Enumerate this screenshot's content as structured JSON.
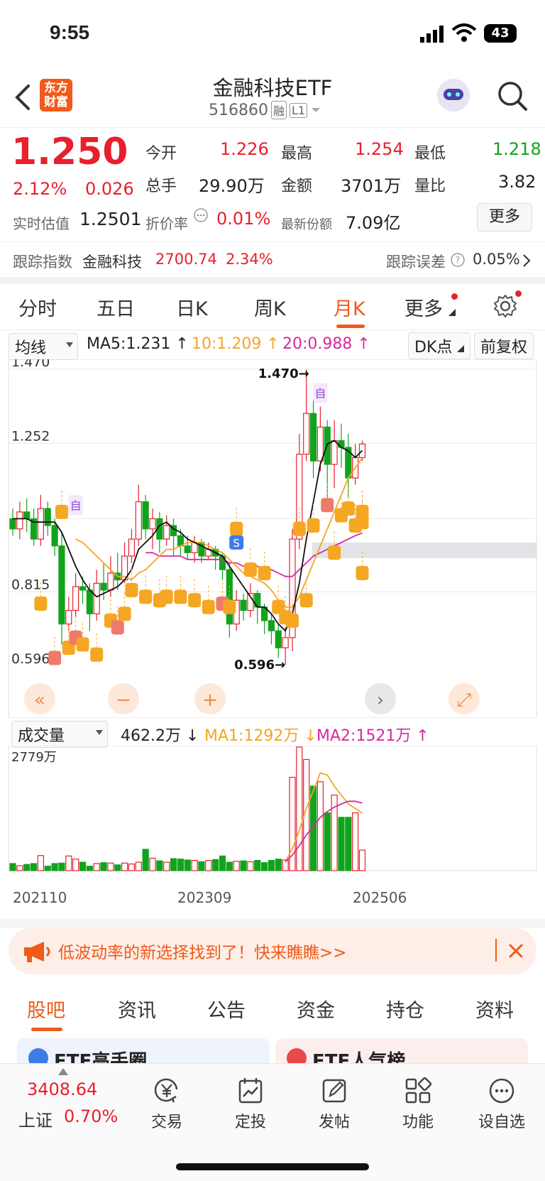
{
  "status": {
    "time": "9:55",
    "battery": "43"
  },
  "header": {
    "logo_line1": "东方",
    "logo_line2": "财富",
    "title": "金融科技ETF",
    "code": "516860",
    "tag1": "融",
    "tag2": "L1"
  },
  "quote": {
    "price": "1.250",
    "pct": "2.12%",
    "chg": "0.026",
    "open_label": "今开",
    "open": "1.226",
    "high_label": "最高",
    "high": "1.254",
    "low_label": "最低",
    "low": "1.218",
    "vol_label": "总手",
    "vol": "29.90万",
    "amt_label": "金额",
    "amt": "3701万",
    "ratio_label": "量比",
    "ratio": "3.82",
    "est_label": "实时估值",
    "est": "1.2501",
    "disc_label": "折价率",
    "disc": "0.01%",
    "share_label": "最新份额",
    "share": "7.09亿",
    "more": "更多"
  },
  "track": {
    "label": "跟踪指数",
    "name": "金融科技",
    "value": "2700.74",
    "pct": "2.34%",
    "err_label": "跟踪误差",
    "err": "0.05%"
  },
  "tabs": [
    "分时",
    "五日",
    "日K",
    "周K",
    "月K",
    "更多"
  ],
  "ma_bar": {
    "select": "均线",
    "ma5": "MA5:1.231",
    "ma10": "10:1.209",
    "ma20": "20:0.988",
    "dk": "DK点",
    "fq": "前复权"
  },
  "price_axis": {
    "top": "1.470",
    "mid": "1.252",
    "low": "0.815",
    "bottom": "0.596",
    "hi_mark": "1.470",
    "lo_mark": "0.596",
    "mark_zi": "自",
    "mark_s": "S"
  },
  "vol_bar": {
    "select": "成交量",
    "vol": "462.2万",
    "ma1": "MA1:1292万",
    "ma2": "MA2:1521万",
    "max": "2779万"
  },
  "x_axis": [
    "202110",
    "202309",
    "202506"
  ],
  "banner": {
    "text": "低波动率的新选择找到了！快来瞧瞧>>"
  },
  "subtabs": [
    "股吧",
    "资讯",
    "公告",
    "资金",
    "持仓",
    "资料"
  ],
  "cards": [
    "ETF高手圈",
    "ETF人气榜"
  ],
  "bottom": {
    "index_value": "3408.64",
    "index_name": "上证",
    "index_pct": "0.70%",
    "nav": [
      "交易",
      "定投",
      "发帖",
      "功能",
      "设自选"
    ]
  },
  "colors": {
    "up": "#e8202b",
    "down": "#12a31c",
    "accent": "#f05a1a",
    "ma10": "#f5a623",
    "ma20": "#d62a9d"
  },
  "chart_data": {
    "type": "candlestick",
    "ylim": [
      0.596,
      1.47
    ],
    "candles": [
      [
        1.03,
        1.0,
        1.06,
        0.98
      ],
      [
        1.0,
        1.05,
        1.08,
        0.97
      ],
      [
        1.05,
        1.03,
        1.09,
        0.99
      ],
      [
        1.03,
        0.97,
        1.06,
        0.95
      ],
      [
        0.97,
        1.06,
        1.1,
        0.95
      ],
      [
        1.06,
        1.01,
        1.08,
        0.98
      ],
      [
        1.01,
        0.95,
        1.03,
        0.92
      ],
      [
        0.95,
        0.72,
        0.99,
        0.66
      ],
      [
        0.72,
        0.76,
        0.8,
        0.7
      ],
      [
        0.76,
        0.83,
        0.87,
        0.74
      ],
      [
        0.83,
        0.82,
        0.86,
        0.78
      ],
      [
        0.82,
        0.75,
        0.84,
        0.7
      ],
      [
        0.75,
        0.84,
        0.88,
        0.73
      ],
      [
        0.84,
        0.82,
        0.9,
        0.79
      ],
      [
        0.82,
        0.87,
        0.92,
        0.8
      ],
      [
        0.87,
        0.85,
        0.93,
        0.82
      ],
      [
        0.85,
        0.92,
        0.96,
        0.84
      ],
      [
        0.92,
        0.97,
        1.0,
        0.9
      ],
      [
        0.97,
        1.08,
        1.13,
        0.95
      ],
      [
        1.08,
        1.0,
        1.1,
        0.97
      ],
      [
        1.0,
        1.03,
        1.06,
        0.94
      ],
      [
        1.03,
        0.97,
        1.05,
        0.93
      ],
      [
        0.97,
        1.01,
        1.04,
        0.95
      ],
      [
        1.01,
        0.98,
        1.03,
        0.92
      ],
      [
        0.98,
        0.95,
        1.0,
        0.92
      ],
      [
        0.95,
        0.93,
        0.98,
        0.91
      ],
      [
        0.93,
        0.96,
        0.98,
        0.9
      ],
      [
        0.96,
        0.92,
        0.97,
        0.9
      ],
      [
        0.92,
        0.94,
        0.96,
        0.91
      ],
      [
        0.94,
        0.92,
        0.95,
        0.88
      ],
      [
        0.92,
        0.88,
        0.93,
        0.85
      ],
      [
        0.88,
        0.72,
        0.9,
        0.68
      ],
      [
        0.72,
        0.79,
        0.82,
        0.7
      ],
      [
        0.79,
        0.76,
        0.81,
        0.73
      ],
      [
        0.76,
        0.81,
        0.84,
        0.74
      ],
      [
        0.81,
        0.77,
        0.82,
        0.72
      ],
      [
        0.77,
        0.73,
        0.78,
        0.69
      ],
      [
        0.73,
        0.7,
        0.75,
        0.66
      ],
      [
        0.7,
        0.65,
        0.72,
        0.62
      ],
      [
        0.65,
        0.68,
        0.71,
        0.6
      ],
      [
        0.68,
        0.97,
        1.0,
        0.64
      ],
      [
        0.97,
        1.22,
        1.28,
        0.94
      ],
      [
        1.22,
        1.34,
        1.47,
        1.2
      ],
      [
        1.34,
        1.2,
        1.38,
        1.15
      ],
      [
        1.2,
        1.3,
        1.36,
        1.17
      ],
      [
        1.3,
        1.19,
        1.32,
        1.08
      ],
      [
        1.19,
        1.26,
        1.32,
        1.12
      ],
      [
        1.26,
        1.24,
        1.31,
        1.18
      ],
      [
        1.24,
        1.15,
        1.28,
        1.09
      ],
      [
        1.15,
        1.21,
        1.25,
        1.13
      ],
      [
        1.21,
        1.25,
        1.26,
        1.2
      ]
    ],
    "volumes": [
      160,
      110,
      140,
      160,
      340,
      100,
      160,
      170,
      330,
      260,
      190,
      100,
      160,
      180,
      170,
      130,
      170,
      150,
      190,
      480,
      280,
      220,
      190,
      270,
      260,
      240,
      230,
      200,
      230,
      250,
      330,
      190,
      210,
      220,
      200,
      230,
      180,
      230,
      260,
      240,
      2100,
      2779,
      2500,
      1900,
      2000,
      1300,
      1700,
      1200,
      1200,
      1300,
      462
    ],
    "ma5": [
      1.03,
      1.03,
      1.03,
      1.02,
      1.02,
      1.02,
      1.02,
      0.99,
      0.94,
      0.89,
      0.85,
      0.82,
      0.8,
      0.81,
      0.82,
      0.83,
      0.85,
      0.88,
      0.94,
      0.96,
      0.98,
      1.01,
      1.02,
      1.0,
      0.99,
      0.97,
      0.96,
      0.95,
      0.94,
      0.93,
      0.92,
      0.89,
      0.86,
      0.83,
      0.8,
      0.77,
      0.77,
      0.75,
      0.72,
      0.7,
      0.75,
      0.84,
      0.97,
      1.08,
      1.19,
      1.25,
      1.26,
      1.24,
      1.23,
      1.21,
      1.231
    ],
    "ma10": [
      null,
      null,
      null,
      null,
      null,
      null,
      null,
      null,
      null,
      0.97,
      0.96,
      0.94,
      0.92,
      0.9,
      0.88,
      0.86,
      0.86,
      0.85,
      0.87,
      0.88,
      0.9,
      0.92,
      0.94,
      0.94,
      0.95,
      0.96,
      0.96,
      0.96,
      0.95,
      0.94,
      0.93,
      0.91,
      0.89,
      0.87,
      0.86,
      0.85,
      0.84,
      0.82,
      0.79,
      0.77,
      0.77,
      0.8,
      0.85,
      0.9,
      0.95,
      1.0,
      1.05,
      1.1,
      1.15,
      1.18,
      1.209
    ],
    "ma20": [
      null,
      null,
      null,
      null,
      null,
      null,
      null,
      null,
      null,
      null,
      null,
      null,
      null,
      null,
      null,
      null,
      null,
      null,
      null,
      0.93,
      0.93,
      0.92,
      0.92,
      0.92,
      0.92,
      0.91,
      0.91,
      0.91,
      0.91,
      0.91,
      0.91,
      0.9,
      0.9,
      0.89,
      0.89,
      0.89,
      0.88,
      0.88,
      0.87,
      0.86,
      0.86,
      0.88,
      0.9,
      0.92,
      0.93,
      0.94,
      0.95,
      0.96,
      0.97,
      0.98,
      0.988
    ],
    "vol_ma1": [
      null,
      null,
      null,
      null,
      null,
      null,
      null,
      null,
      null,
      null,
      null,
      null,
      null,
      null,
      null,
      null,
      null,
      null,
      null,
      null,
      null,
      null,
      null,
      null,
      null,
      null,
      null,
      null,
      null,
      null,
      null,
      null,
      null,
      null,
      null,
      null,
      null,
      null,
      null,
      200,
      500,
      900,
      1400,
      1800,
      2200,
      2150,
      1900,
      1700,
      1500,
      1400,
      1292
    ],
    "vol_ma2": [
      null,
      null,
      null,
      null,
      null,
      null,
      null,
      null,
      null,
      null,
      null,
      null,
      null,
      null,
      null,
      null,
      null,
      null,
      null,
      null,
      null,
      null,
      null,
      null,
      null,
      null,
      null,
      null,
      null,
      null,
      null,
      null,
      null,
      null,
      null,
      null,
      null,
      null,
      null,
      200,
      350,
      560,
      800,
      1000,
      1200,
      1330,
      1430,
      1500,
      1560,
      1560,
      1521
    ]
  }
}
